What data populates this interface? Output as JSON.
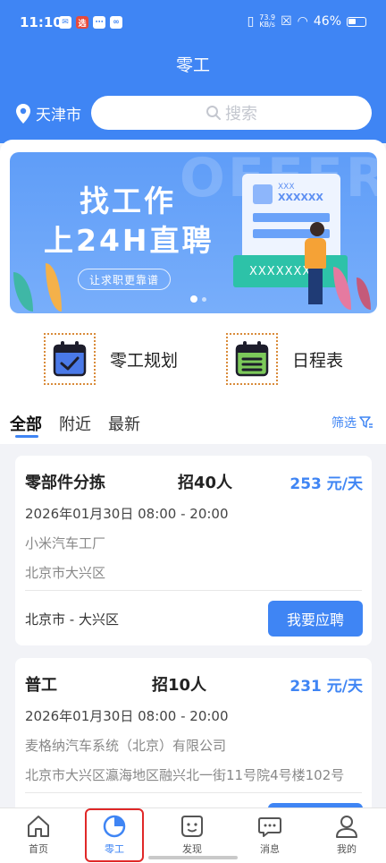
{
  "status_bar": {
    "time": "11:10",
    "net_speed_value": "73.9",
    "net_speed_unit": "KB/s",
    "battery": "46%"
  },
  "header": {
    "title": "零工",
    "location": "天津市",
    "search_placeholder": "搜索"
  },
  "banner": {
    "line1": "找工作",
    "line2": "上24H直聘",
    "tag": "让求职更靠谱",
    "bg_word": "OFFER",
    "card_small": "XXX",
    "card_code": "XXXXXX",
    "green_label": "XXXXXXX"
  },
  "shortcuts": [
    {
      "label": "零工规划",
      "icon": "calendar-check-icon"
    },
    {
      "label": "日程表",
      "icon": "calendar-list-icon"
    }
  ],
  "tabs": [
    {
      "label": "全部",
      "active": true
    },
    {
      "label": "附近",
      "active": false
    },
    {
      "label": "最新",
      "active": false
    }
  ],
  "filter_label": "筛选",
  "jobs": [
    {
      "title": "零部件分拣",
      "headcount": "招40人",
      "wage": "253 元/天",
      "time": "2026年01月30日 08:00 - 20:00",
      "company": "小米汽车工厂",
      "address": "北京市大兴区",
      "region": "北京市 - 大兴区",
      "apply_label": "我要应聘"
    },
    {
      "title": "普工",
      "headcount": "招10人",
      "wage": "231 元/天",
      "time": "2026年01月30日 08:00 - 20:00",
      "company": "麦格纳汽车系统（北京）有限公司",
      "address": "北京市大兴区瀛海地区融兴北一街11号院4号楼102号",
      "region": "",
      "apply_label": ""
    }
  ],
  "bottom_nav": [
    {
      "label": "首页",
      "icon": "home-icon",
      "active": false
    },
    {
      "label": "零工",
      "icon": "pie-chart-icon",
      "active": true
    },
    {
      "label": "发现",
      "icon": "discover-face-icon",
      "active": false
    },
    {
      "label": "消息",
      "icon": "chat-bubble-icon",
      "active": false
    },
    {
      "label": "我的",
      "icon": "user-icon",
      "active": false
    }
  ],
  "colors": {
    "primary": "#3f85f4",
    "highlight_border": "#e02828",
    "shortcut_border": "#d98b3a"
  }
}
